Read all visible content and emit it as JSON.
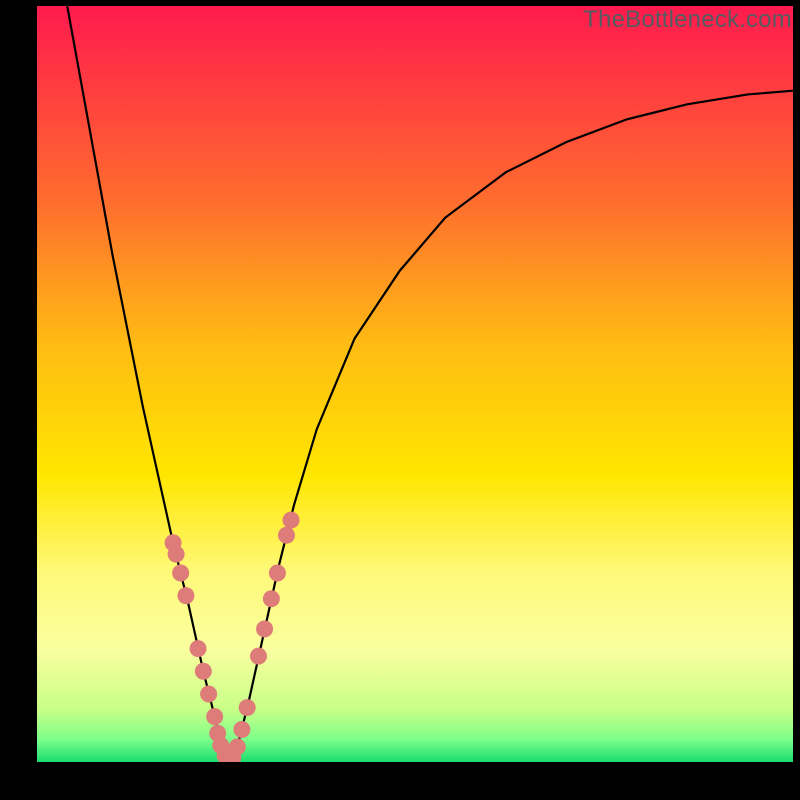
{
  "watermark": "TheBottleneck.com",
  "chart_data": {
    "type": "line",
    "title": "",
    "xlabel": "",
    "ylabel": "",
    "xlim": [
      0,
      100
    ],
    "ylim": [
      0,
      100
    ],
    "grid": false,
    "legend": false,
    "background_gradient": {
      "stops": [
        {
          "offset": 0,
          "color": "#ff1a4d"
        },
        {
          "offset": 25,
          "color": "#ff6a2f"
        },
        {
          "offset": 45,
          "color": "#ffbc13"
        },
        {
          "offset": 62,
          "color": "#ffe600"
        },
        {
          "offset": 75,
          "color": "#fff97a"
        },
        {
          "offset": 85,
          "color": "#faff9f"
        },
        {
          "offset": 93,
          "color": "#c9ff87"
        },
        {
          "offset": 97,
          "color": "#7dff8a"
        },
        {
          "offset": 100,
          "color": "#1bdc70"
        }
      ]
    },
    "series": [
      {
        "name": "main-curve",
        "color": "#000000",
        "x": [
          4,
          6,
          8,
          10,
          12,
          14,
          16,
          18,
          20,
          22,
          23.5,
          24.5,
          25.3,
          26.5,
          28,
          30,
          32,
          34,
          37,
          42,
          48,
          54,
          62,
          70,
          78,
          86,
          94,
          100
        ],
        "y": [
          100,
          89,
          78,
          67,
          57,
          47,
          38,
          29,
          21,
          12,
          6,
          2,
          0,
          2,
          8,
          17,
          26,
          34,
          44,
          56,
          65,
          72,
          78,
          82,
          85,
          87,
          88.3,
          88.8
        ]
      },
      {
        "name": "marker-points",
        "color": "#de7c7a",
        "marker": "circle",
        "x": [
          18.0,
          18.4,
          19.0,
          19.7,
          21.3,
          22.0,
          22.7,
          23.5,
          23.9,
          24.3,
          24.9,
          25.3,
          25.9,
          26.5,
          27.1,
          27.8,
          29.3,
          30.1,
          31.0,
          31.8,
          33.0,
          33.6
        ],
        "y": [
          29.0,
          27.5,
          25.0,
          22.0,
          15.0,
          12.0,
          9.0,
          6.0,
          3.8,
          2.2,
          0.8,
          0.0,
          0.6,
          2.0,
          4.3,
          7.2,
          14.0,
          17.6,
          21.6,
          25.0,
          30.0,
          32.0
        ]
      }
    ]
  }
}
